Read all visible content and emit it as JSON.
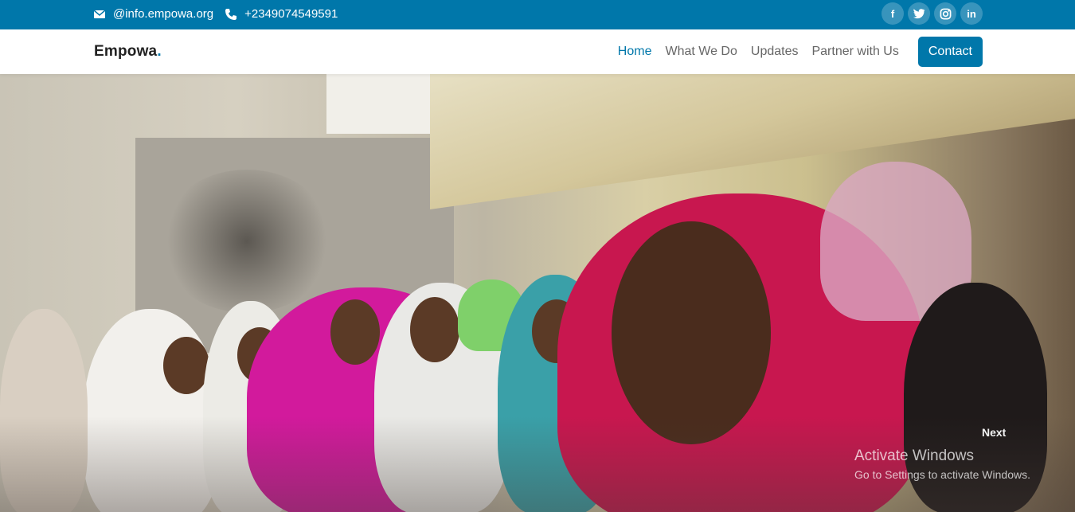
{
  "topbar": {
    "email": "@info.empowa.org",
    "phone": "+2349074549591",
    "email_icon": "envelope-icon",
    "phone_icon": "phone-icon",
    "social": [
      {
        "name": "facebook-icon",
        "glyph": "f"
      },
      {
        "name": "twitter-icon",
        "glyph": "t"
      },
      {
        "name": "instagram-icon",
        "glyph": "◎"
      },
      {
        "name": "linkedin-icon",
        "glyph": "in"
      }
    ]
  },
  "navbar": {
    "brand": "Empowa",
    "brand_dot": ".",
    "links": [
      "Home",
      "What We Do",
      "Updates",
      "Partner with Us"
    ],
    "active": "Home",
    "contact_label": "Contact"
  },
  "hero": {
    "next_label": "Next"
  },
  "os_watermark": {
    "title": "Activate Windows",
    "subtitle": "Go to Settings to activate Windows."
  },
  "colors": {
    "brand_blue": "#0077aa",
    "topbar_bg": "#0077aa",
    "nav_text": "#666666"
  }
}
